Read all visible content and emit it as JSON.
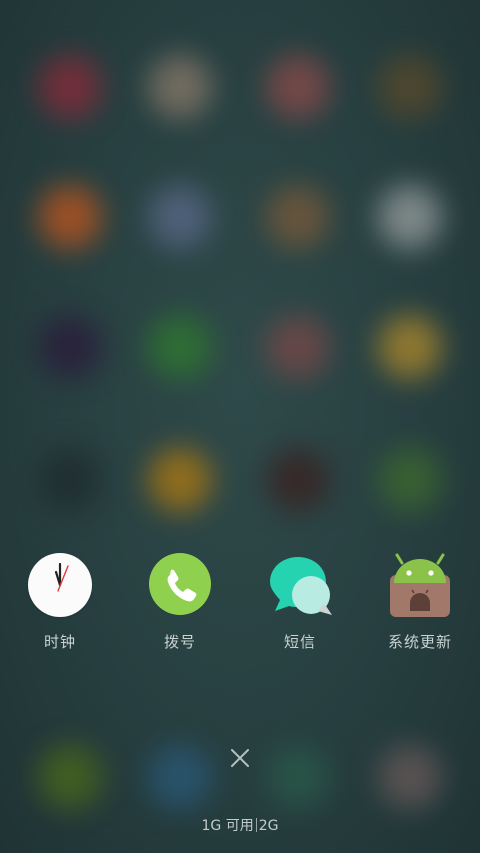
{
  "background": {
    "blur_colors": [
      "#8b2a3a",
      "#8a7a6a",
      "#8e4a4a",
      "#5a4a2a",
      "#c0561e",
      "#5a6a8a",
      "#7a5a3a",
      "#9aa0a0",
      "#2a1a3a",
      "#2e7a2e",
      "#7a4848",
      "#b08a2a",
      "#1e2a2e",
      "#b07a10",
      "#3a2020",
      "#3e6a2e",
      "#4a6a1a",
      "#2a5a7a",
      "#2a5a4a",
      "#6a5a5a"
    ]
  },
  "recent_apps": [
    {
      "name": "clock",
      "label": "时钟",
      "icon": "clock-icon",
      "color": "#fbfbfb"
    },
    {
      "name": "dialer",
      "label": "拨号",
      "icon": "phone-icon",
      "color": "#8fd14f"
    },
    {
      "name": "messages",
      "label": "短信",
      "icon": "message-bubble-icon",
      "color": "#25d3b0"
    },
    {
      "name": "system-update",
      "label": "系统更新",
      "icon": "android-package-icon",
      "color": "#8bc34a"
    }
  ],
  "close": {
    "icon": "close-icon"
  },
  "memory": {
    "available": "1G 可用",
    "total": "2G"
  }
}
